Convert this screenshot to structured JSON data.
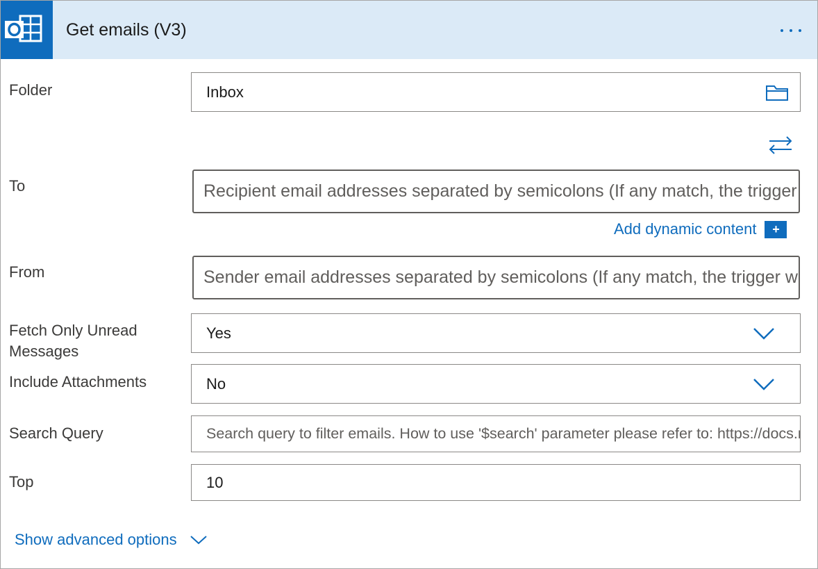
{
  "header": {
    "title": "Get emails (V3)",
    "app_icon": "outlook-icon",
    "more_icon": "more-options-icon"
  },
  "fields": {
    "folder": {
      "label": "Folder",
      "value": "Inbox",
      "icon": "folder-icon"
    },
    "swap_icon": "swap-arrows-icon",
    "to": {
      "label": "To",
      "placeholder": "Recipient email addresses separated by semicolons (If any match, the trigger will run)"
    },
    "dynamic_content": {
      "label": "Add dynamic content",
      "plus": "+"
    },
    "from": {
      "label": "From",
      "placeholder": "Sender email addresses separated by semicolons (If any match, the trigger will run)"
    },
    "fetch_unread": {
      "label_line1": "Fetch Only Unread",
      "label_line2": "Messages",
      "value": "Yes"
    },
    "include_attachments": {
      "label": "Include Attachments",
      "value": "No"
    },
    "search_query": {
      "label": "Search Query",
      "placeholder": "Search query to filter emails. How to use '$search' parameter please refer to: https://docs.microsoft.com"
    },
    "top": {
      "label": "Top",
      "value": "10"
    }
  },
  "footer": {
    "show_advanced": "Show advanced options"
  },
  "colors": {
    "accent": "#0f6cbd",
    "header_bg": "#dbeaf7"
  }
}
